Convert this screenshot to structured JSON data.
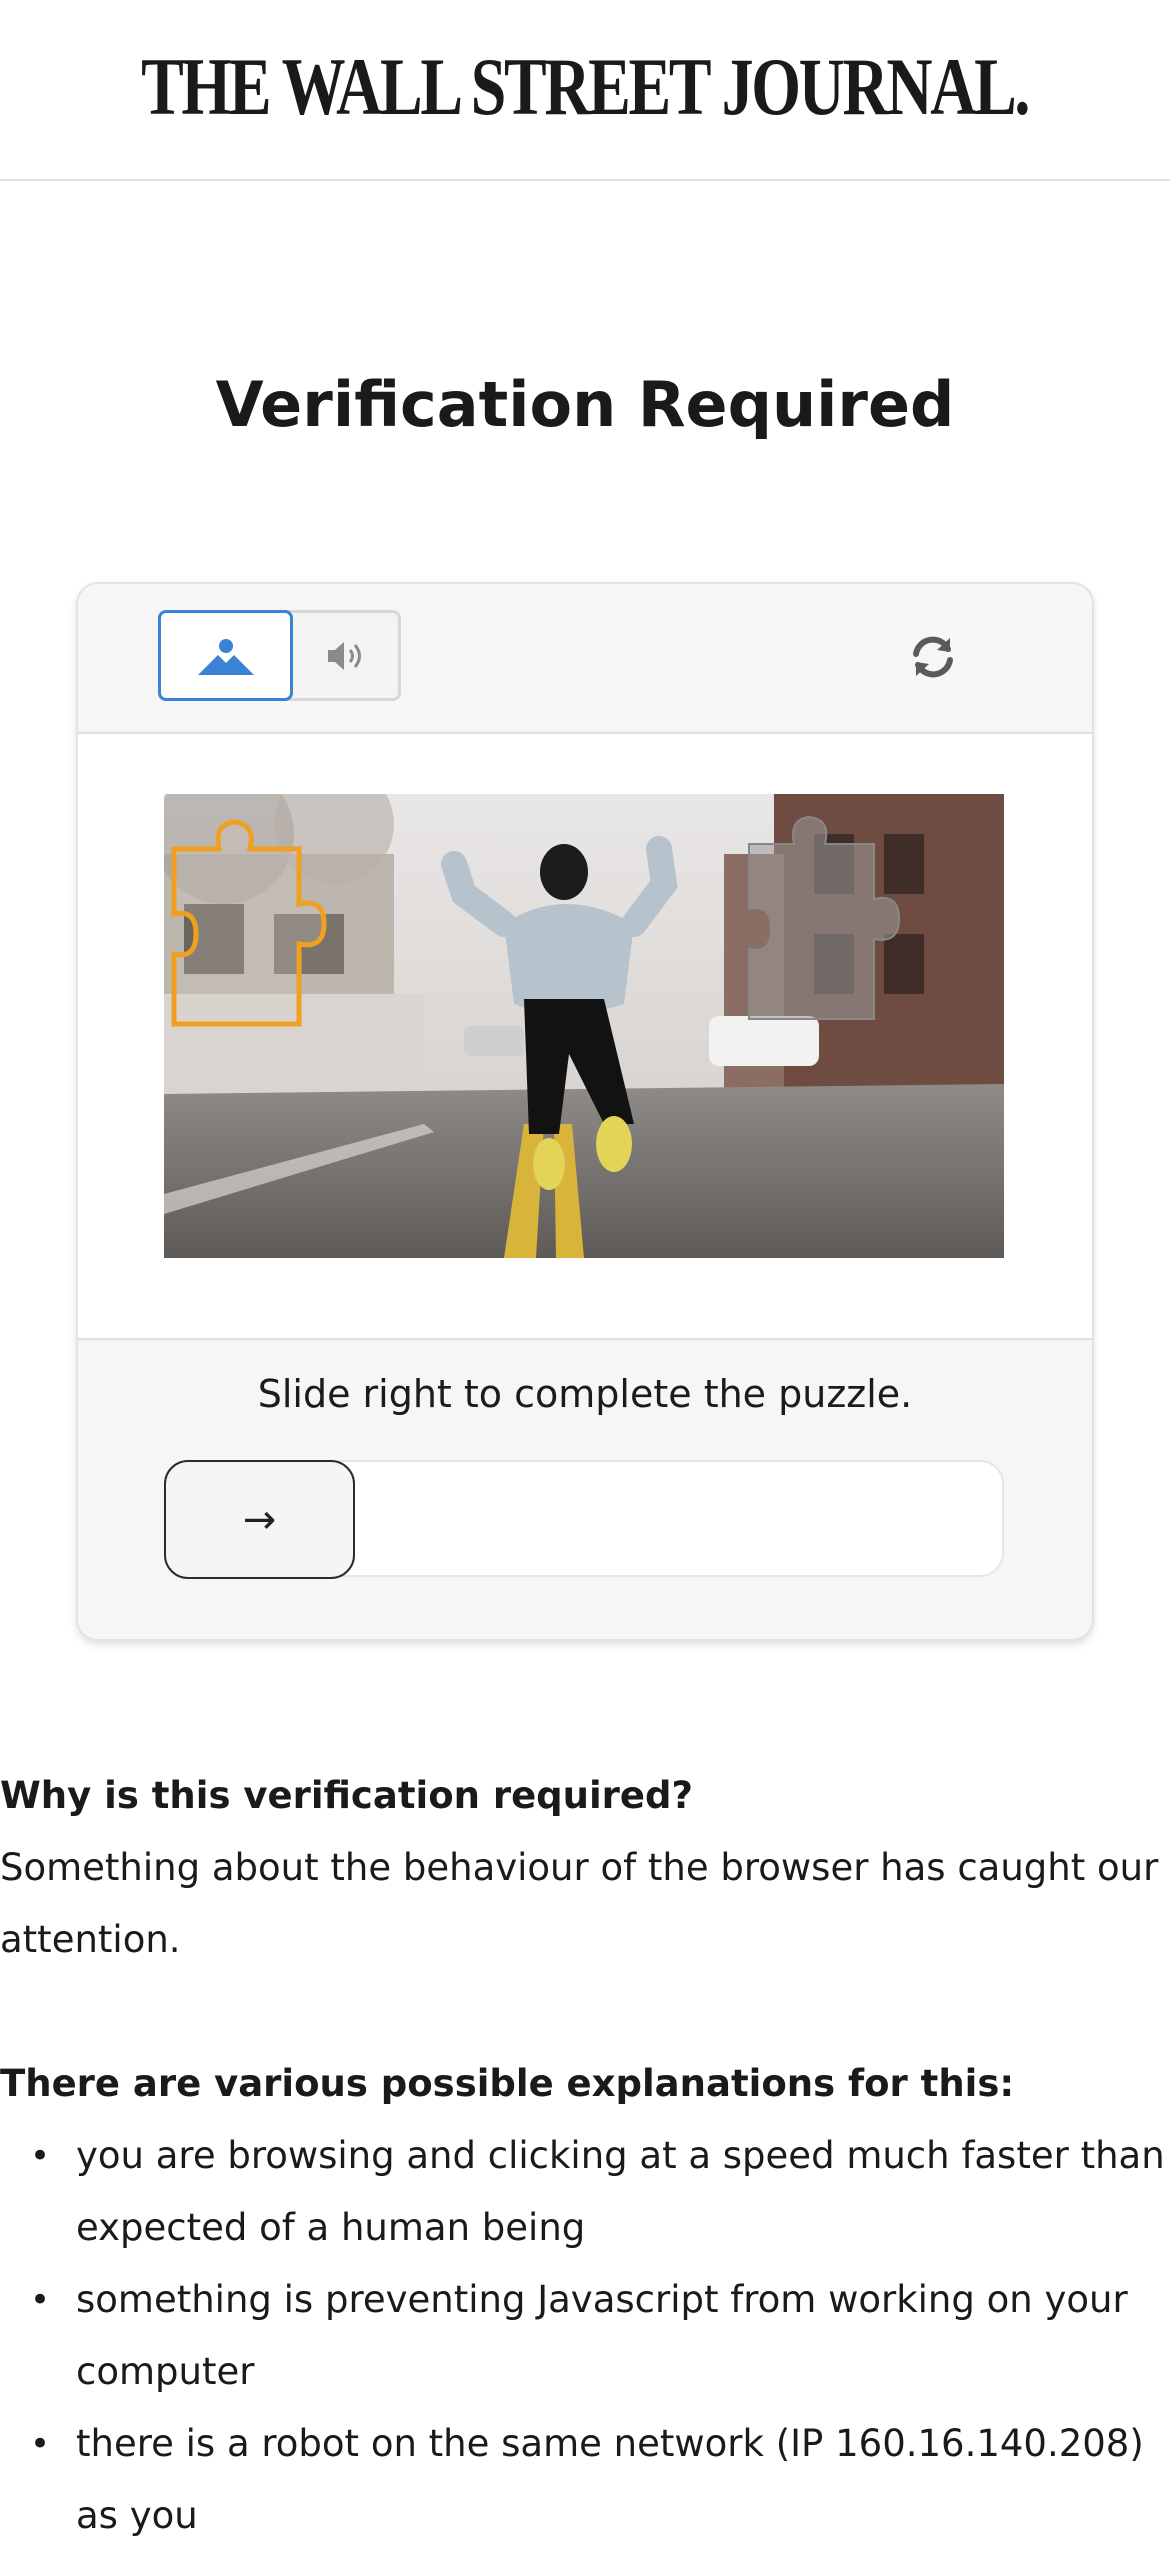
{
  "header": {
    "logo_text": "THE WALL STREET JOURNAL."
  },
  "page": {
    "title": "Verification Required"
  },
  "captcha": {
    "modes": [
      {
        "name": "image",
        "icon": "image-icon",
        "selected": true
      },
      {
        "name": "audio",
        "icon": "speaker-icon",
        "selected": false
      }
    ],
    "refresh_icon": "refresh-icon",
    "instruction": "Slide right to complete the puzzle.",
    "slider_icon": "arrow-right-icon",
    "slider_arrow": "→",
    "slider_progress": 0,
    "accent_color": "#3b82d6",
    "piece_outline_color": "#f0a020"
  },
  "info": {
    "why_heading": "Why is this verification required?",
    "why_text": "Something about the behaviour of the browser has caught our attention.",
    "explanations_heading": "There are various possible explanations for this:",
    "explanations": [
      "you are browsing and clicking at a speed much faster than expected of a human being",
      "something is preventing Javascript from working on your computer",
      "there is a robot on the same network (IP 160.16.140.208) as you"
    ]
  }
}
